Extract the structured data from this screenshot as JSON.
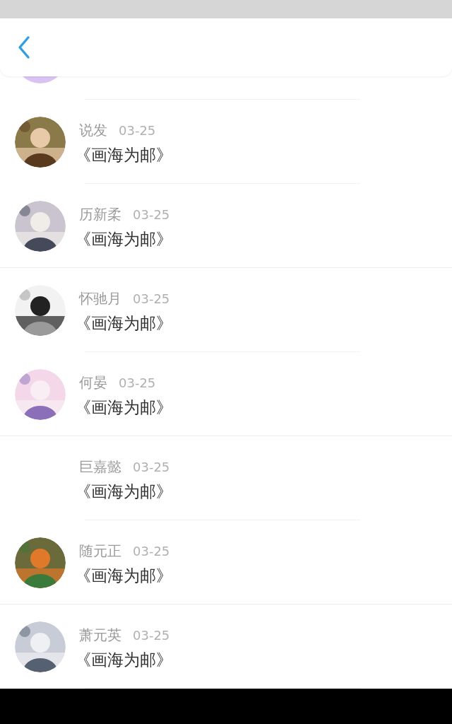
{
  "header": {
    "back": true
  },
  "comments": [
    {
      "name": "说发",
      "date": "03-25",
      "text": "《画海为邮》",
      "avatar": true
    },
    {
      "name": "历新柔",
      "date": "03-25",
      "text": "《画海为邮》",
      "avatar": true
    },
    {
      "name": "怀驰月",
      "date": "03-25",
      "text": "《画海为邮》",
      "avatar": true
    },
    {
      "name": "何晏",
      "date": "03-25",
      "text": "《画海为邮》",
      "avatar": true
    },
    {
      "name": "巨嘉懿",
      "date": "03-25",
      "text": "《画海为邮》",
      "avatar": false
    },
    {
      "name": "随元正",
      "date": "03-25",
      "text": "《画海为邮》",
      "avatar": true
    },
    {
      "name": "萧元英",
      "date": "03-25",
      "text": "《画海为邮》",
      "avatar": true
    }
  ]
}
